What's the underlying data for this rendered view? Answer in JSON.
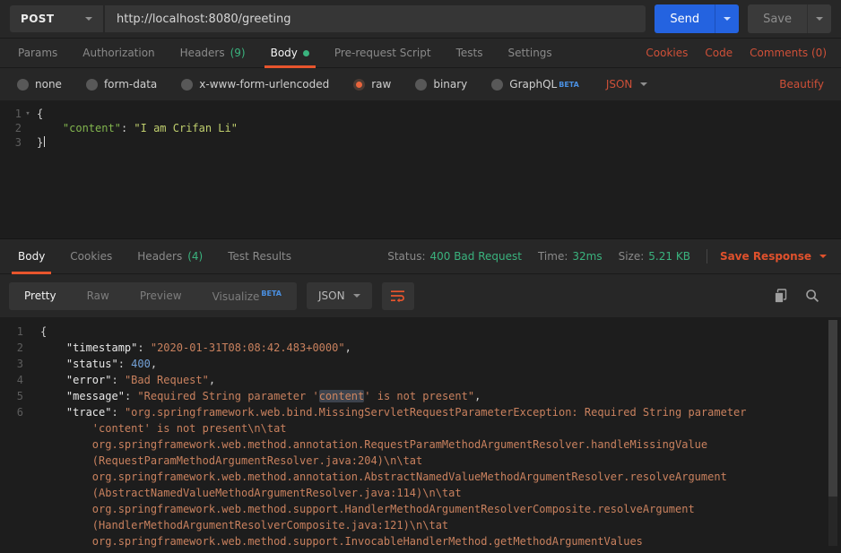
{
  "request_bar": {
    "method": "POST",
    "url": "http://localhost:8080/greeting",
    "send_label": "Send",
    "save_label": "Save"
  },
  "request_tabs": {
    "items": [
      {
        "label": "Params"
      },
      {
        "label": "Authorization"
      },
      {
        "label": "Headers",
        "count": "(9)"
      },
      {
        "label": "Body",
        "active": true,
        "dot": true
      },
      {
        "label": "Pre-request Script"
      },
      {
        "label": "Tests"
      },
      {
        "label": "Settings"
      }
    ],
    "links": [
      {
        "label": "Cookies"
      },
      {
        "label": "Code"
      },
      {
        "label": "Comments (0)"
      }
    ]
  },
  "body_options": {
    "items": [
      {
        "label": "none"
      },
      {
        "label": "form-data"
      },
      {
        "label": "x-www-form-urlencoded"
      },
      {
        "label": "raw",
        "selected": true
      },
      {
        "label": "binary"
      },
      {
        "label": "GraphQL",
        "beta": "BETA"
      }
    ],
    "language": "JSON",
    "beautify_label": "Beautify"
  },
  "request_editor": {
    "lines": [
      {
        "num": "1",
        "fold": true,
        "segments": [
          {
            "c": "p",
            "t": "{"
          }
        ]
      },
      {
        "num": "2",
        "segments": [
          {
            "c": "p",
            "t": "    "
          },
          {
            "c": "gk",
            "t": "\"content\""
          },
          {
            "c": "p",
            "t": ": "
          },
          {
            "c": "gs",
            "t": "\"I am Crifan Li\""
          }
        ]
      },
      {
        "num": "3",
        "cursor": true,
        "segments": [
          {
            "c": "p",
            "t": "}"
          }
        ]
      }
    ]
  },
  "response_header": {
    "tabs": [
      {
        "label": "Body",
        "active": true
      },
      {
        "label": "Cookies"
      },
      {
        "label": "Headers",
        "count": "(4)"
      },
      {
        "label": "Test Results"
      }
    ],
    "status_label": "Status:",
    "status_value": "400 Bad Request",
    "time_label": "Time:",
    "time_value": "32ms",
    "size_label": "Size:",
    "size_value": "5.21 KB",
    "save_response_label": "Save Response"
  },
  "response_toolbar": {
    "views": [
      {
        "label": "Pretty",
        "active": true
      },
      {
        "label": "Raw"
      },
      {
        "label": "Preview"
      },
      {
        "label": "Visualize",
        "beta": "BETA"
      }
    ],
    "language": "JSON"
  },
  "response_editor": {
    "lines": [
      {
        "num": "1",
        "segments": [
          {
            "c": "p",
            "t": "{"
          }
        ]
      },
      {
        "num": "2",
        "segments": [
          {
            "c": "p",
            "t": "    "
          },
          {
            "c": "k",
            "t": "\"timestamp\""
          },
          {
            "c": "p",
            "t": ": "
          },
          {
            "c": "s",
            "t": "\"2020-01-31T08:08:42.483+0000\""
          },
          {
            "c": "p",
            "t": ","
          }
        ]
      },
      {
        "num": "3",
        "segments": [
          {
            "c": "p",
            "t": "    "
          },
          {
            "c": "k",
            "t": "\"status\""
          },
          {
            "c": "p",
            "t": ": "
          },
          {
            "c": "n",
            "t": "400"
          },
          {
            "c": "p",
            "t": ","
          }
        ]
      },
      {
        "num": "4",
        "segments": [
          {
            "c": "p",
            "t": "    "
          },
          {
            "c": "k",
            "t": "\"error\""
          },
          {
            "c": "p",
            "t": ": "
          },
          {
            "c": "s",
            "t": "\"Bad Request\""
          },
          {
            "c": "p",
            "t": ","
          }
        ]
      },
      {
        "num": "5",
        "segments": [
          {
            "c": "p",
            "t": "    "
          },
          {
            "c": "k",
            "t": "\"message\""
          },
          {
            "c": "p",
            "t": ": "
          },
          {
            "c": "s",
            "t": "\"Required String parameter '"
          },
          {
            "c": "hl",
            "t": "content"
          },
          {
            "c": "s",
            "t": "' is not present\""
          },
          {
            "c": "p",
            "t": ","
          }
        ]
      },
      {
        "num": "6",
        "segments": [
          {
            "c": "p",
            "t": "    "
          },
          {
            "c": "k",
            "t": "\"trace\""
          },
          {
            "c": "p",
            "t": ": "
          },
          {
            "c": "s",
            "t": "\"org.springframework.web.bind.MissingServletRequestParameterException: Required String parameter"
          }
        ]
      },
      {
        "num": "",
        "segments": [
          {
            "c": "p",
            "t": "        "
          },
          {
            "c": "s",
            "t": "'content' is not present\\n\\tat"
          }
        ]
      },
      {
        "num": "",
        "segments": [
          {
            "c": "p",
            "t": "        "
          },
          {
            "c": "s",
            "t": "org.springframework.web.method.annotation.RequestParamMethodArgumentResolver.handleMissingValue"
          }
        ]
      },
      {
        "num": "",
        "segments": [
          {
            "c": "p",
            "t": "        "
          },
          {
            "c": "s",
            "t": "(RequestParamMethodArgumentResolver.java:204)\\n\\tat"
          }
        ]
      },
      {
        "num": "",
        "segments": [
          {
            "c": "p",
            "t": "        "
          },
          {
            "c": "s",
            "t": "org.springframework.web.method.annotation.AbstractNamedValueMethodArgumentResolver.resolveArgument"
          }
        ]
      },
      {
        "num": "",
        "segments": [
          {
            "c": "p",
            "t": "        "
          },
          {
            "c": "s",
            "t": "(AbstractNamedValueMethodArgumentResolver.java:114)\\n\\tat"
          }
        ]
      },
      {
        "num": "",
        "segments": [
          {
            "c": "p",
            "t": "        "
          },
          {
            "c": "s",
            "t": "org.springframework.web.method.support.HandlerMethodArgumentResolverComposite.resolveArgument"
          }
        ]
      },
      {
        "num": "",
        "segments": [
          {
            "c": "p",
            "t": "        "
          },
          {
            "c": "s",
            "t": "(HandlerMethodArgumentResolverComposite.java:121)\\n\\tat"
          }
        ]
      },
      {
        "num": "",
        "segments": [
          {
            "c": "p",
            "t": "        "
          },
          {
            "c": "s",
            "t": "org.springframework.web.method.support.InvocableHandlerMethod.getMethodArgumentValues"
          }
        ]
      }
    ]
  }
}
